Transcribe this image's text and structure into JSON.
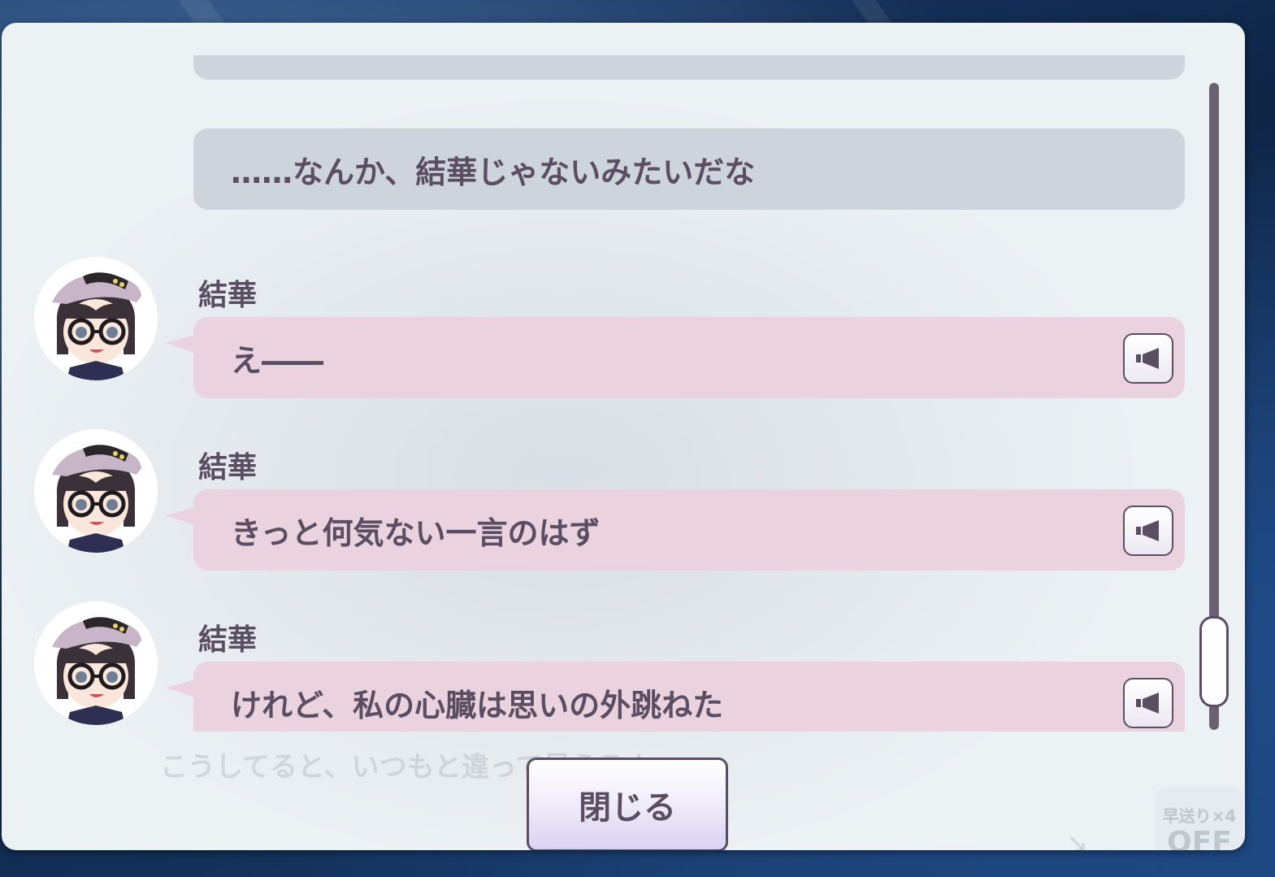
{
  "log": {
    "entries": [
      {
        "type": "narration",
        "text": ""
      },
      {
        "type": "narration",
        "text": "……なんか、結華じゃないみたいだな"
      },
      {
        "type": "character",
        "speaker": "結華",
        "text": "え――",
        "avatar_icon": "character-avatar",
        "voice_icon": "speaker-icon"
      },
      {
        "type": "character",
        "speaker": "結華",
        "text": "きっと何気ない一言のはず",
        "avatar_icon": "character-avatar",
        "voice_icon": "speaker-icon"
      },
      {
        "type": "character",
        "speaker": "結華",
        "text": "けれど、私の心臓は思いの外跳ねた",
        "avatar_icon": "character-avatar",
        "voice_icon": "speaker-icon"
      }
    ]
  },
  "background": {
    "dialogue_text": "こうしてると、いつもと違って見えるよ",
    "fast_forward_label": "早送り×4",
    "fast_forward_state": "OFF"
  },
  "close_button": {
    "label": "閉じる"
  },
  "colors": {
    "text": "#5b4d62",
    "narration_bubble": "#cdd4dc",
    "character_bubble": "#ead2de",
    "panel": "#eef3f5"
  }
}
